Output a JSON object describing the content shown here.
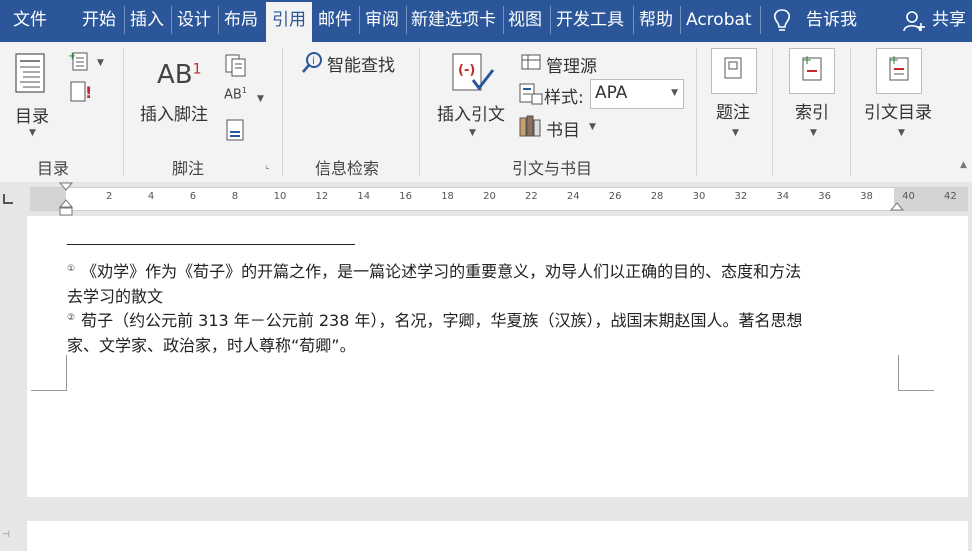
{
  "tabs": [
    {
      "label": "文件"
    },
    {
      "label": "开始"
    },
    {
      "label": "插入"
    },
    {
      "label": "设计"
    },
    {
      "label": "布局"
    },
    {
      "label": "引用",
      "active": true
    },
    {
      "label": "邮件"
    },
    {
      "label": "审阅"
    },
    {
      "label": "新建选项卡"
    },
    {
      "label": "视图"
    },
    {
      "label": "开发工具"
    },
    {
      "label": "帮助"
    },
    {
      "label": "Acrobat"
    }
  ],
  "tell_me": "告诉我",
  "share": "共享",
  "ribbon": {
    "toc": {
      "button": "目录",
      "group": "目录"
    },
    "footnote": {
      "button": "插入脚注",
      "group": "脚注"
    },
    "research": {
      "button": "智能查找",
      "group": "信息检索"
    },
    "citations": {
      "insert": "插入引文",
      "manage": "管理源",
      "style_label": "样式:",
      "style_value": "APA",
      "bibliography": "书目",
      "group": "引文与书目"
    },
    "captions": {
      "button": "题注"
    },
    "index": {
      "button": "索引"
    },
    "toa": {
      "button": "引文目录"
    }
  },
  "ruler_ticks": [
    "2",
    "4",
    "6",
    "8",
    "10",
    "12",
    "14",
    "16",
    "18",
    "20",
    "22",
    "24",
    "26",
    "28",
    "30",
    "32",
    "34",
    "36",
    "38",
    "40",
    "42"
  ],
  "footnotes": [
    {
      "mark": "①",
      "line1": "《劝学》作为《荀子》的开篇之作，是一篇论述学习的重要意义，劝导人们以正确的目的、态度和方法",
      "line2": "去学习的散文"
    },
    {
      "mark": "②",
      "line1": "荀子（约公元前 313 年－公元前 238 年），名况，字卿，华夏族（汉族），战国末期赵国人。著名思想",
      "line2": "家、文学家、政治家，时人尊称“荀卿”。"
    }
  ],
  "colors": {
    "accent": "#2b579a",
    "ribbon_bg": "#f3f3f3",
    "canvas": "#e6e6e6"
  }
}
